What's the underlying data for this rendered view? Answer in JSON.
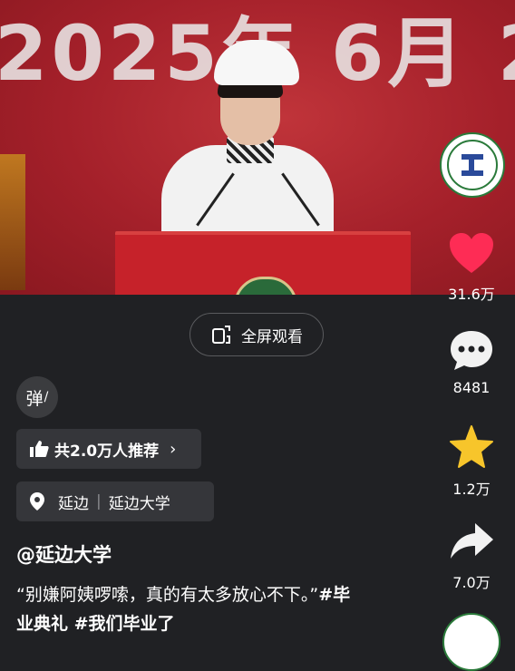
{
  "video": {
    "backdrop_text": "2025年 6月 2"
  },
  "rail": {
    "like_count": "31.6万",
    "comment_count": "8481",
    "favorite_count": "1.2万",
    "share_count": "7.0万"
  },
  "fullscreen": {
    "label": "全屏观看"
  },
  "danmaku": {
    "label": "弹"
  },
  "recommend": {
    "label": "共2.0万人推荐"
  },
  "location": {
    "city": "延边",
    "place": "延边大学"
  },
  "post": {
    "author": "@延边大学",
    "text": "“别嫌阿姨啰嗦，真的有太多放心不下。”",
    "tags": "#毕业典礼 #我们毕业了"
  },
  "colors": {
    "like": "#fe2c55",
    "star": "#f7c52b",
    "background": "#202124"
  }
}
